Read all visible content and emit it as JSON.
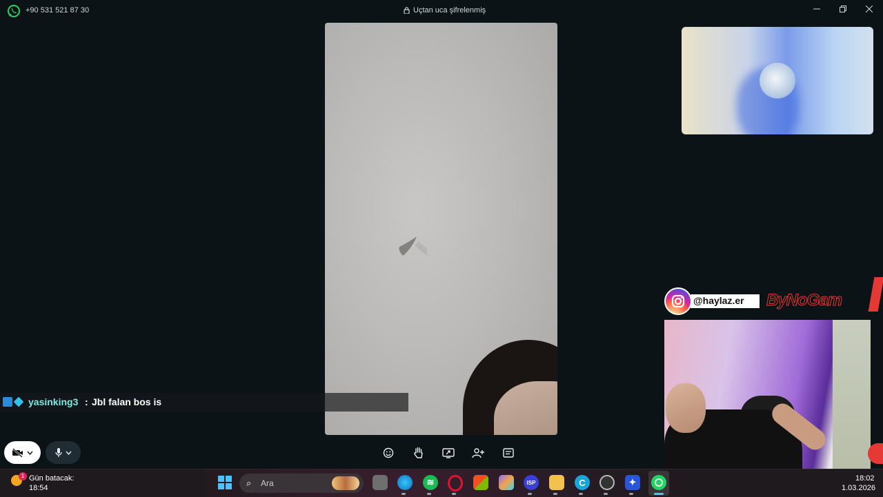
{
  "titlebar": {
    "phone": "+90 531 521 87 30",
    "encryption": "Uçtan uca şifrelenmiş",
    "icons": [
      "whatsapp-icon",
      "lock-icon",
      "minimize-icon",
      "restore-icon",
      "close-icon"
    ]
  },
  "chat_overlay": {
    "username": "yasinking3",
    "separator": ":",
    "message": "Jbl falan bos is",
    "username_color": "#7ee8e0"
  },
  "streamer_overlay": {
    "instagram_handle": "@haylaz.er",
    "brand": "ByNoGam"
  },
  "call_controls": {
    "camera": "camera-off-icon",
    "microphone": "microphone-icon",
    "tools": [
      "emoji-icon",
      "raise-hand-icon",
      "screen-share-icon",
      "add-participant-icon",
      "more-options-icon"
    ]
  },
  "taskbar": {
    "weather_badge": "1",
    "weather_line1": "Gün batacak:",
    "weather_line2": "18:54",
    "search_label": "Ara",
    "apps": [
      "file-explorer-icon",
      "edge-icon",
      "spotify-icon",
      "opera-icon",
      "store-icon",
      "copilot-icon",
      "vpn-icon",
      "folder-icon",
      "ccleaner-icon",
      "obs-icon",
      "steam-icon",
      "whatsapp-icon"
    ],
    "time": "18:02",
    "date": "1.03.2026"
  },
  "colors": {
    "background": "#0c1317",
    "whatsapp_green": "#25d366",
    "start_blue": "#4cc2ff"
  }
}
